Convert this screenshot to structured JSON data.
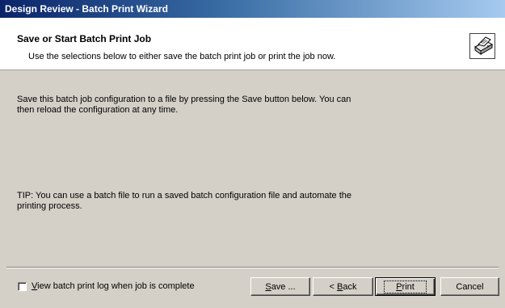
{
  "window": {
    "title": "Design Review - Batch Print Wizard"
  },
  "header": {
    "title": "Save or Start Batch Print Job",
    "subtitle": "Use the selections below to either save the batch print job or print the job now.",
    "icon": "printer-icon"
  },
  "body": {
    "paragraph1": "Save this batch job configuration to a file by pressing the Save button below. You can then reload the configuration at any time.",
    "paragraph2": "TIP: You can use a batch file to run a saved batch configuration file and automate the printing process."
  },
  "footer": {
    "checkbox": {
      "label_mnemonic": "V",
      "label_rest": "iew batch print log when job is complete",
      "checked": false
    },
    "buttons": {
      "save_mnemonic": "S",
      "save_rest": "ave ...",
      "back_prefix": "< ",
      "back_mnemonic": "B",
      "back_rest": "ack",
      "print_mnemonic": "P",
      "print_rest": "rint",
      "cancel": "Cancel"
    }
  },
  "colors": {
    "dialog_bg": "#d4d0c8",
    "titlebar_start": "#0a246a",
    "titlebar_end": "#a6caf0",
    "header_bg": "#ffffff"
  }
}
